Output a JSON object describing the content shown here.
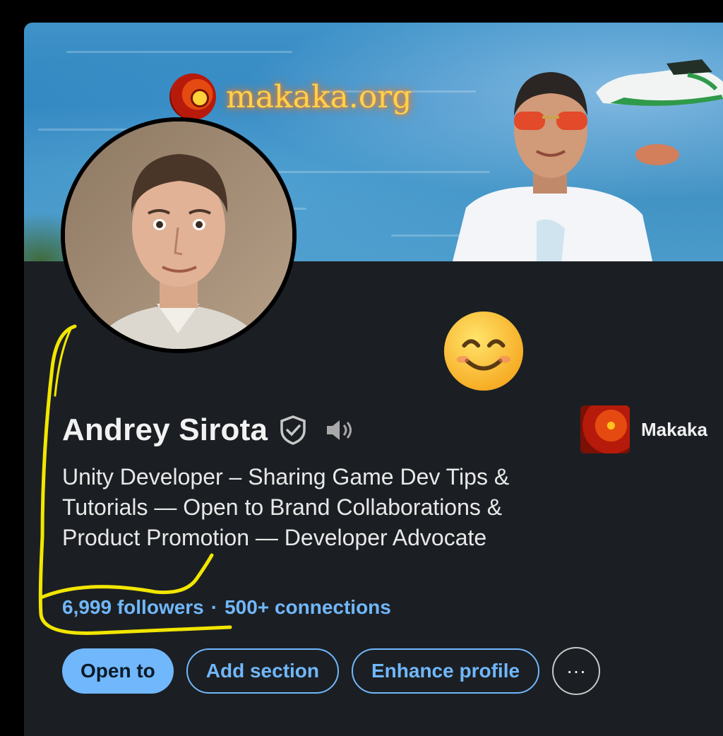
{
  "banner": {
    "logo_text": "makaka.org",
    "logo_icon": "makaka-logo-icon"
  },
  "profile": {
    "name": "Andrey Sirota",
    "verified_icon": "shield-check-icon",
    "pronunciation_icon": "speaker-icon",
    "headline": "Unity Developer – Sharing Game Dev Tips & Tutorials — Open to Brand Collaborations & Product Promotion — Developer Advocate",
    "followers": "6,999 followers",
    "separator": "·",
    "connections": "500+ connections",
    "emoji": "smiling-face-icon"
  },
  "company": {
    "name": "Makaka",
    "logo_icon": "makaka-logo-icon"
  },
  "actions": {
    "open_to": "Open to",
    "add_section": "Add section",
    "enhance_profile": "Enhance profile",
    "more": "···"
  },
  "colors": {
    "accent": "#71b7fb",
    "background": "#1b1f23",
    "text": "#f2f2f2",
    "annotation": "#f2e600"
  }
}
